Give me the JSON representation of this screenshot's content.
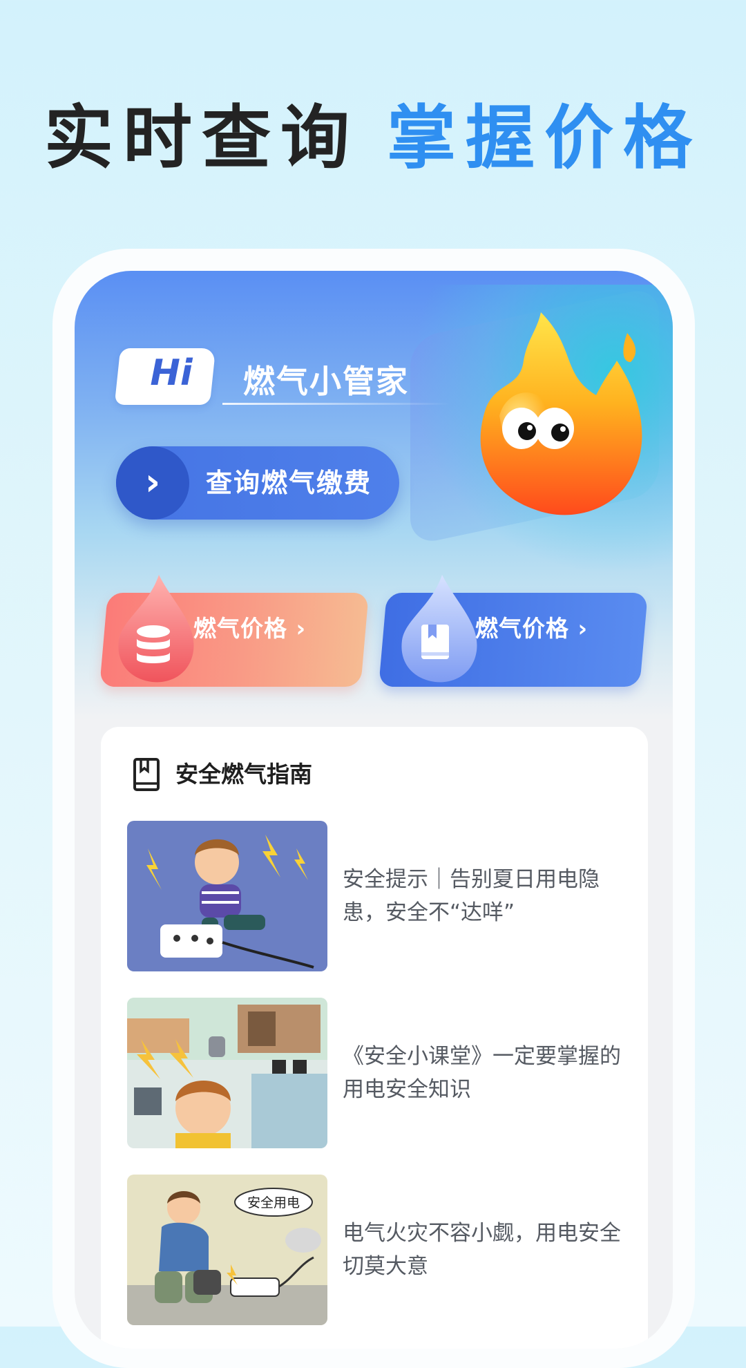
{
  "headline": {
    "dark": "实时查询",
    "blue": "掌握价格"
  },
  "hero": {
    "hi_badge": "Hi",
    "title": "燃气小管家",
    "query_button": "查询燃气缴费",
    "query_arrow": "›"
  },
  "cards": [
    {
      "label": "燃气价格 ›",
      "icon": "database-icon",
      "color": "#fb7b78"
    },
    {
      "label": "燃气价格 ›",
      "icon": "book-icon",
      "color": "#4574e4"
    }
  ],
  "guide": {
    "title": "安全燃气指南",
    "articles": [
      {
        "title": "安全提示｜告别夏日用电隐患，安全不“达咩”"
      },
      {
        "title": "《安全小课堂》一定要掌握的用电安全知识"
      },
      {
        "title": "电气火灾不容小觑，用电安全切莫大意",
        "thumb_caption": "安全用电"
      }
    ]
  },
  "colors": {
    "accent_blue": "#2f8ff1",
    "button_blue": "#4574e4",
    "card_red": "#fb7b78"
  }
}
